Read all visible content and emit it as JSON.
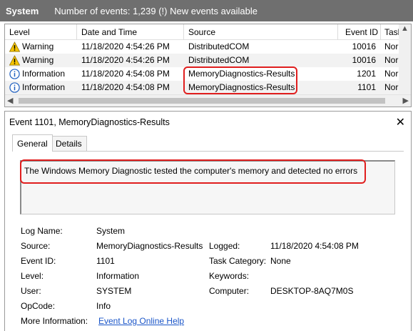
{
  "titlebar": {
    "log_name": "System",
    "event_info": "Number of events: 1,239 (!) New events available"
  },
  "events": {
    "columns": [
      "Level",
      "Date and Time",
      "Source",
      "Event ID",
      "Task"
    ],
    "rows": [
      {
        "level": "Warning",
        "date": "11/18/2020 4:54:26 PM",
        "source": "DistributedCOM",
        "event_id": "10016",
        "task": "Nor",
        "icon": "warning-icon"
      },
      {
        "level": "Warning",
        "date": "11/18/2020 4:54:26 PM",
        "source": "DistributedCOM",
        "event_id": "10016",
        "task": "Nor",
        "icon": "warning-icon"
      },
      {
        "level": "Information",
        "date": "11/18/2020 4:54:08 PM",
        "source": "MemoryDiagnostics-Results",
        "event_id": "1201",
        "task": "Nor",
        "icon": "information-icon"
      },
      {
        "level": "Information",
        "date": "11/18/2020 4:54:08 PM",
        "source": "MemoryDiagnostics-Results",
        "event_id": "1101",
        "task": "Nor",
        "icon": "information-icon"
      }
    ]
  },
  "detail": {
    "title": "Event 1101, MemoryDiagnostics-Results",
    "tabs": [
      "General",
      "Details"
    ],
    "description": "The Windows Memory Diagnostic tested the computer's memory and detected no errors",
    "log_name_label": "Log Name:",
    "log_name": "System",
    "source_label": "Source:",
    "source": "MemoryDiagnostics-Results",
    "logged_label": "Logged:",
    "logged": "11/18/2020 4:54:08 PM",
    "event_id_label": "Event ID:",
    "event_id": "1101",
    "task_category_label": "Task Category:",
    "task_category": "None",
    "level_label": "Level:",
    "level": "Information",
    "keywords_label": "Keywords:",
    "keywords": "",
    "user_label": "User:",
    "user": "SYSTEM",
    "computer_label": "Computer:",
    "computer": "DESKTOP-8AQ7M0S",
    "opcode_label": "OpCode:",
    "opcode": "Info",
    "more_info_label": "More Information:",
    "more_info_link": "Event Log Online Help"
  },
  "colors": {
    "highlight": "#e01e1e",
    "titlebar": "#6f6f6f",
    "link": "#1a55c8"
  }
}
